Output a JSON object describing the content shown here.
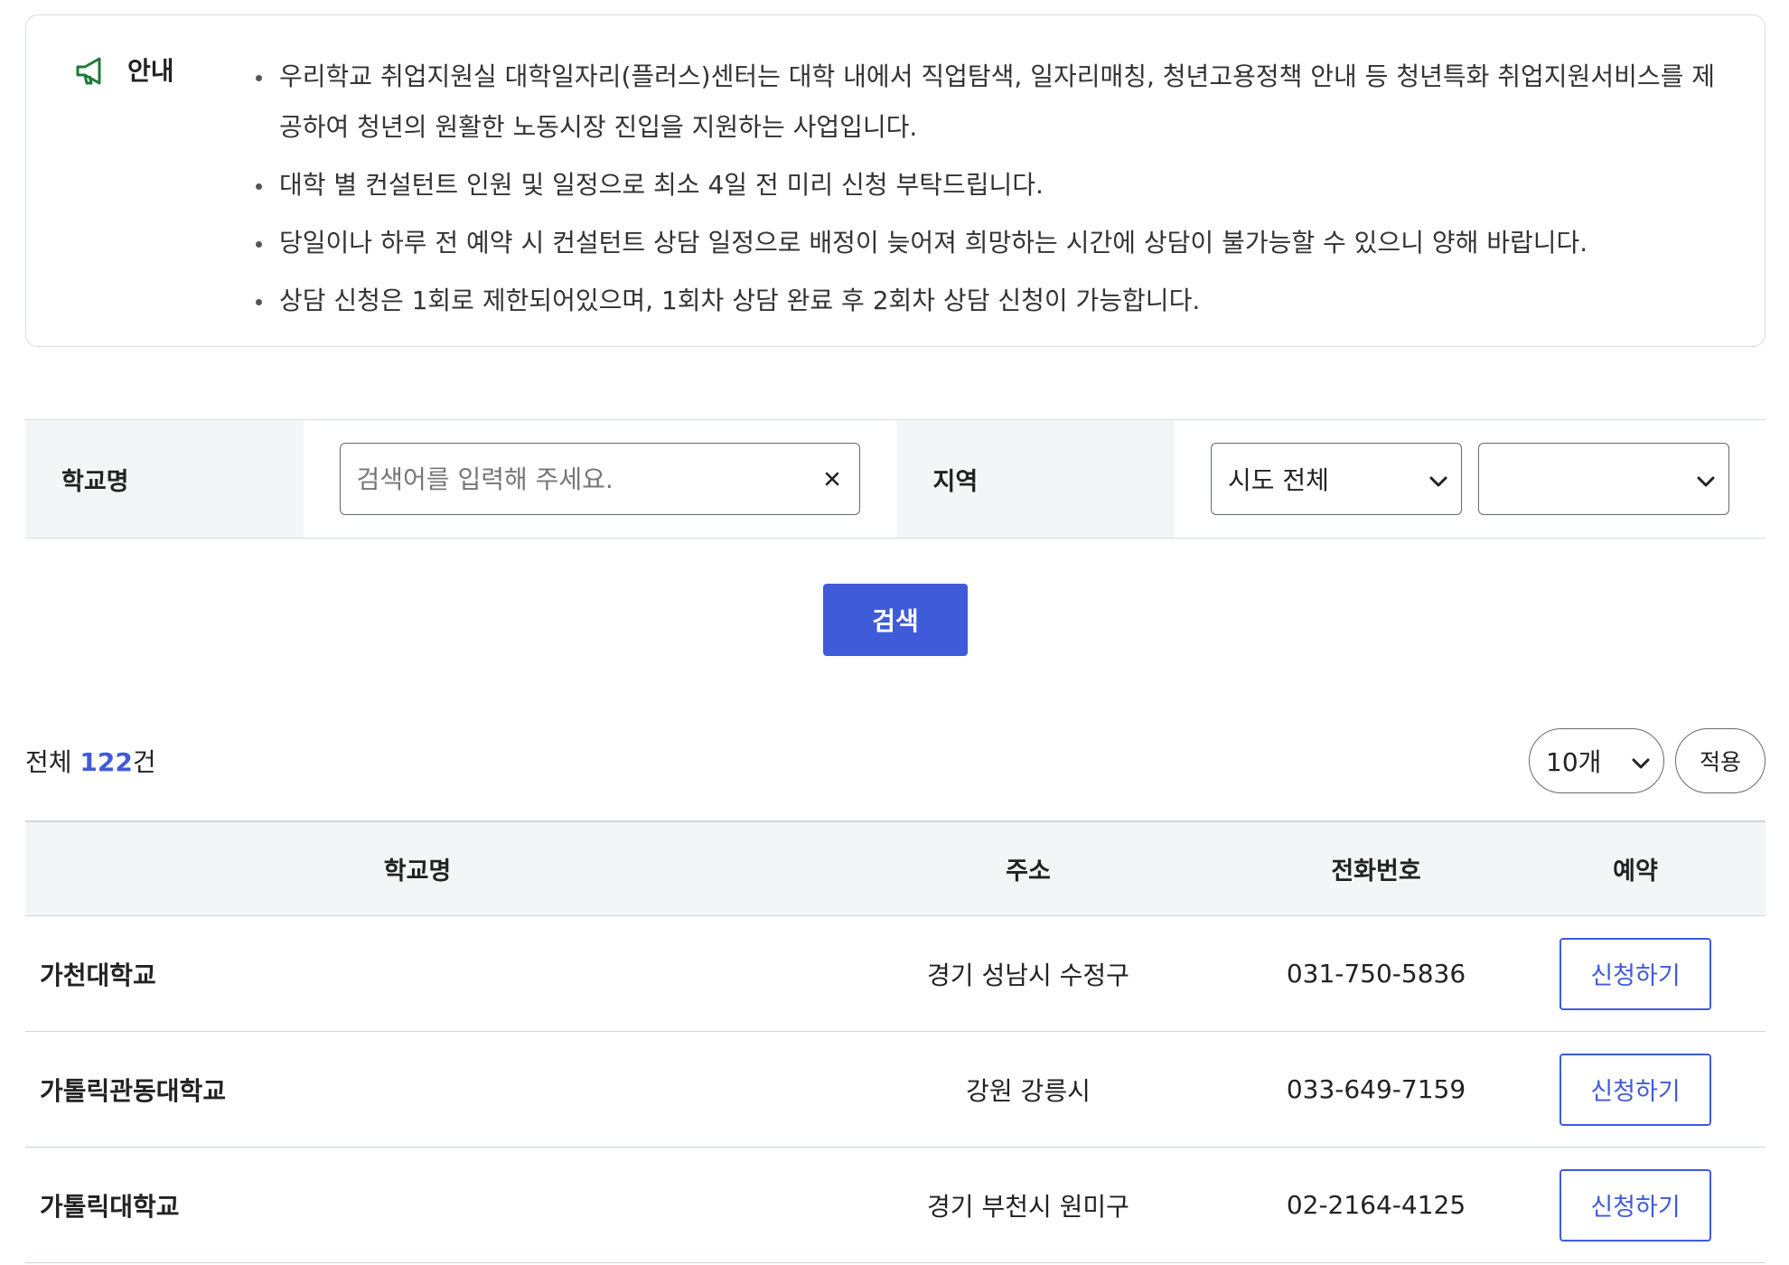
{
  "notice": {
    "title": "안내",
    "items": [
      "우리학교 취업지원실 대학일자리(플러스)센터는 대학 내에서 직업탐색, 일자리매칭, 청년고용정책 안내 등 청년특화 취업지원서비스를 제공하여 청년의 원활한 노동시장 진입을 지원하는 사업입니다.",
      "대학 별 컨설턴트 인원 및 일정으로 최소 4일 전 미리 신청 부탁드립니다.",
      "당일이나 하루 전 예약 시 컨설턴트 상담 일정으로 배정이 늦어져 희망하는 시간에 상담이 불가능할 수 있으니 양해 바랍니다.",
      "상담 신청은 1회로 제한되어있으며, 1회차 상담 완료 후 2회차 상담 신청이 가능합니다."
    ]
  },
  "search": {
    "school_label": "학교명",
    "school_placeholder": "검색어를 입력해 주세요.",
    "school_value": "",
    "region_label": "지역",
    "sido_value": "시도 전체",
    "sigungu_value": "",
    "button_label": "검색"
  },
  "results": {
    "total_prefix": "전체 ",
    "total_count": "122",
    "total_suffix": "건",
    "page_size": "10개",
    "apply_label": "적용"
  },
  "table": {
    "headers": {
      "name": "학교명",
      "address": "주소",
      "phone": "전화번호",
      "reserve": "예약"
    },
    "rows": [
      {
        "name": "가천대학교",
        "address": "경기 성남시 수정구",
        "phone": "031-750-5836",
        "action": "신청하기"
      },
      {
        "name": "가톨릭관동대학교",
        "address": "강원 강릉시",
        "phone": "033-649-7159",
        "action": "신청하기"
      },
      {
        "name": "가톨릭대학교",
        "address": "경기 부천시 원미구",
        "phone": "02-2164-4125",
        "action": "신청하기"
      }
    ]
  },
  "colors": {
    "accent": "#3f5bd9",
    "notice_icon": "#1f7a3c",
    "border": "#d9dde3",
    "header_bg": "#f4f5f7"
  },
  "icons": {
    "notice": "megaphone-icon",
    "clear": "close-icon",
    "dropdown": "chevron-down-icon"
  }
}
